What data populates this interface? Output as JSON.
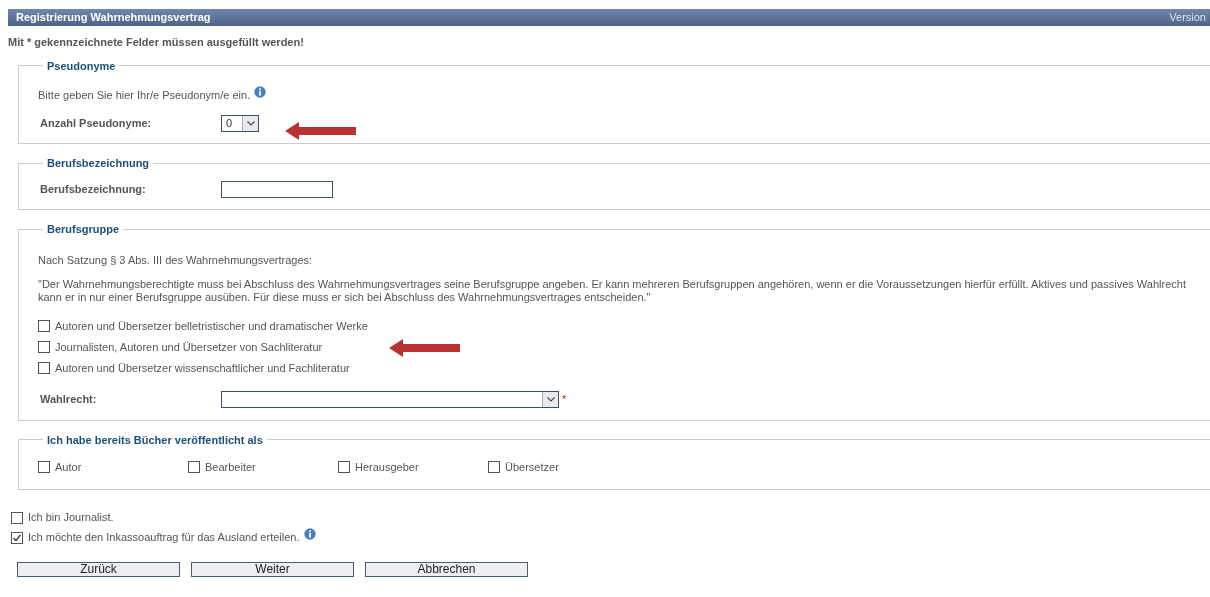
{
  "window": {
    "title": "Registrierung Wahrnehmungsvertrag",
    "version": "Version"
  },
  "required_note": "Mit * gekennzeichnete Felder müssen ausgefüllt werden!",
  "pseudonyme": {
    "legend": "Pseudonyme",
    "hint": "Bitte geben Sie hier Ihr/e Pseudonym/e ein.",
    "hint_info": true,
    "label": "Anzahl Pseudonyme:",
    "value": "0"
  },
  "berufsbezeichnung": {
    "legend": "Berufsbezeichnung",
    "label": "Berufsbezeichnung:"
  },
  "berufsgruppe": {
    "legend": "Berufsgruppe",
    "intro": "Nach Satzung § 3 Abs. III des Wahrnehmungsvertrages:",
    "quote": "\"Der Wahrnehmungsberechtigte muss bei Abschluss des Wahrnehmungsvertrages seine Berufsgruppe angeben. Er kann mehreren Berufsgruppen angehören, wenn er die Voraussetzungen hierfür erfüllt. Aktives und passives Wahlrecht kann er in nur einer Berufsgruppe ausüben. Für diese muss er sich bei Abschluss des Wahrnehmungsvertrages entscheiden.\"",
    "options": [
      {
        "label": "Autoren und Übersetzer belletristischer und dramatischer Werke",
        "checked": false
      },
      {
        "label": "Journalisten, Autoren und Übersetzer von Sachliteratur",
        "checked": false
      },
      {
        "label": "Autoren und Übersetzer wissenschaftlicher und Fachliteratur",
        "checked": false
      }
    ],
    "wahlrecht": {
      "label": "Wahlrecht:",
      "required_mark": "*"
    }
  },
  "buecher": {
    "legend": "Ich habe bereits Bücher veröffentlicht als",
    "options": [
      {
        "label": "Autor",
        "checked": false
      },
      {
        "label": "Bearbeiter",
        "checked": false
      },
      {
        "label": "Herausgeber",
        "checked": false
      },
      {
        "label": "Übersetzer",
        "checked": false
      }
    ]
  },
  "extra_options": [
    {
      "label": "Ich bin Journalist.",
      "checked": false,
      "info": false
    },
    {
      "label": "Ich möchte den Inkassoauftrag für das Ausland erteilen.",
      "checked": true,
      "info": true
    }
  ],
  "buttons": [
    "Zurück",
    "Weiter",
    "Abbrechen"
  ]
}
